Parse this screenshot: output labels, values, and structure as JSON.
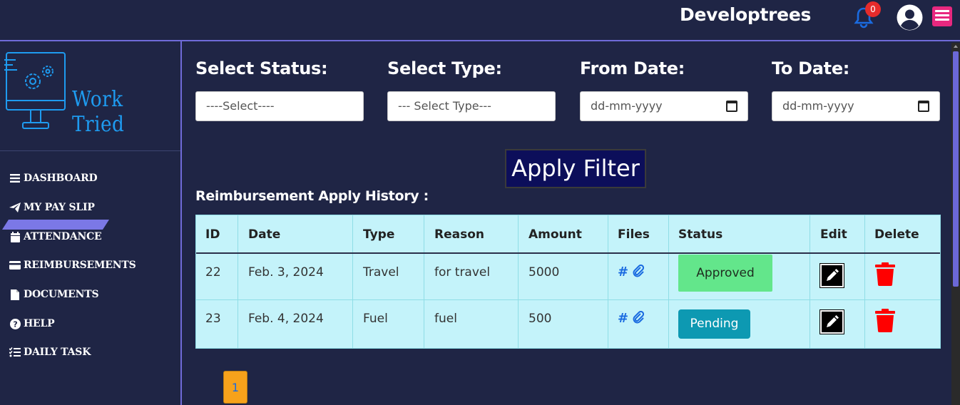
{
  "header": {
    "brand": "Developtrees",
    "notification_count": "0"
  },
  "sidebar": {
    "logo_text": "Work Tried",
    "items": [
      {
        "label": "DASHBOARD",
        "icon": "bars-icon"
      },
      {
        "label": "MY PAY SLIP",
        "icon": "paper-plane-icon"
      },
      {
        "label": "ATTENDANCE",
        "icon": "calendar-icon"
      },
      {
        "label": "REIMBURSEMENTS",
        "icon": "credit-card-icon",
        "active": true
      },
      {
        "label": "DOCUMENTS",
        "icon": "file-icon"
      },
      {
        "label": "HELP",
        "icon": "question-circle-icon"
      },
      {
        "label": "DAILY TASK",
        "icon": "list-check-icon"
      }
    ]
  },
  "filters": {
    "status_label": "Select Status:",
    "status_value": "----Select----",
    "type_label": "Select Type:",
    "type_value": "--- Select Type---",
    "from_label": "From Date:",
    "from_placeholder": "dd-mm-yyyy",
    "to_label": "To Date:",
    "to_placeholder": "dd-mm-yyyy",
    "apply_label": "Apply Filter"
  },
  "history": {
    "title": "Reimbursement Apply History :",
    "columns": [
      "ID",
      "Date",
      "Type",
      "Reason",
      "Amount",
      "Files",
      "Status",
      "Edit",
      "Delete"
    ],
    "rows": [
      {
        "id": "22",
        "date": "Feb. 3, 2024",
        "type": "Travel",
        "reason": "for travel",
        "amount": "5000",
        "files": "#",
        "status": "Approved"
      },
      {
        "id": "23",
        "date": "Feb. 4, 2024",
        "type": "Fuel",
        "reason": "fuel",
        "amount": "500",
        "files": "#",
        "status": "Pending"
      }
    ]
  },
  "pagination": {
    "current_page": "1"
  },
  "colors": {
    "background": "#1f2545",
    "accent": "#6f6bd8",
    "table_bg": "#c4f3fa",
    "approved": "#63e68b",
    "pending": "#0d99b2",
    "delete": "#ff0000",
    "page_btn": "#f7a21b"
  }
}
